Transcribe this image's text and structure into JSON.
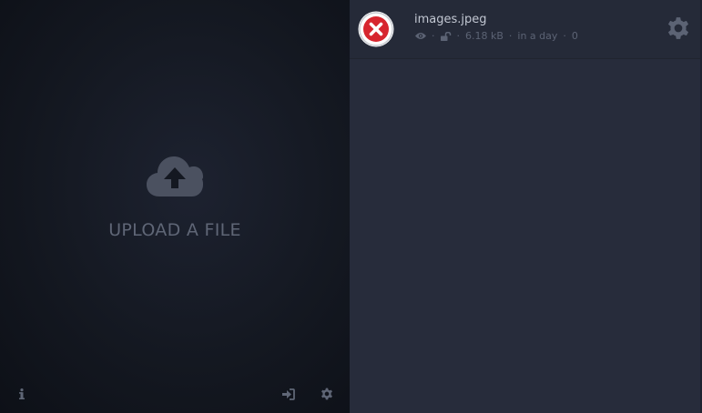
{
  "upload": {
    "label": "UPLOAD A FILE",
    "icon": "cloud-upload-icon"
  },
  "footer": {
    "info_icon": "info-icon",
    "login_icon": "login-icon",
    "settings_icon": "gear-icon"
  },
  "file": {
    "name": "images.jpeg",
    "status_icon": "error-x-icon",
    "visibility_icon": "eye-icon",
    "lock_icon": "unlock-icon",
    "size": "6.18 kB",
    "expires": "in a day",
    "downloads": "0",
    "settings_icon": "gear-icon"
  },
  "colors": {
    "left_bg": "#141821",
    "right_bg": "#272c3b",
    "muted": "#5f6676",
    "error_red": "#d7262f"
  }
}
